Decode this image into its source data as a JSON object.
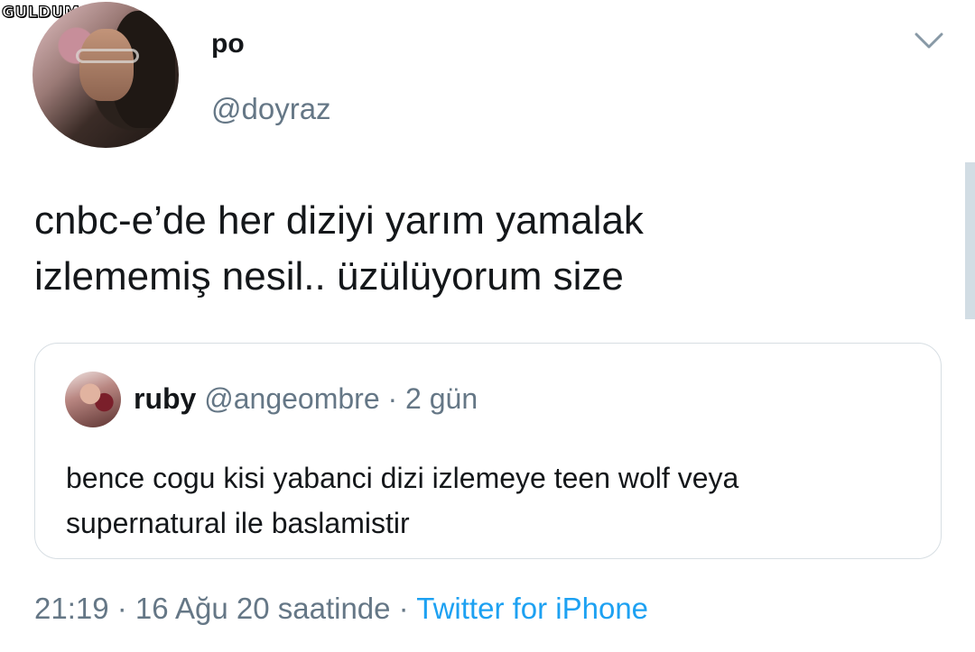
{
  "watermark": "GULDUM.NET",
  "author": {
    "display_name": "po",
    "handle": "@doyraz"
  },
  "tweet": {
    "text_line1": "cnbc-e’de her diziyi yarım yamalak",
    "text_line2": "izlememiş nesil.. üzülüyorum size"
  },
  "quoted": {
    "display_name": "ruby",
    "handle": "@angeombre",
    "separator": " · ",
    "age": "2 gün",
    "text_line1": "bence cogu kisi yabanci dizi izlemeye teen wolf veya",
    "text_line2": "supernatural ile baslamistir"
  },
  "footer": {
    "time": "21:19",
    "separator": " · ",
    "date": "16 Ağu 20 saatinde",
    "separator2": " · ",
    "source": "Twitter for iPhone"
  },
  "icons": {
    "menu": "chevron-down-icon"
  },
  "colors": {
    "text": "#14171a",
    "secondary": "#657786",
    "link": "#1da1f2",
    "border": "#d7dee3"
  }
}
